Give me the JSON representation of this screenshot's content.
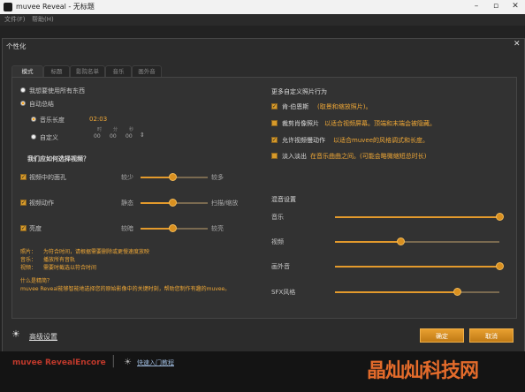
{
  "window": {
    "title": "muvee Reveal - 无标题"
  },
  "menu": [
    "文件(F)",
    "帮助(H)"
  ],
  "dialog": {
    "title": "个性化",
    "tabs": [
      "模式",
      "标题",
      "影院名单",
      "音乐",
      "画外音"
    ],
    "left": {
      "radio_manual": "我想要使用所有东西",
      "radio_auto": "自动总结",
      "sub_music_len": "音乐长度",
      "music_len_value": "02:03",
      "sub_custom": "自定义",
      "time_units": [
        "时",
        "分",
        "秒"
      ],
      "time_values": [
        "00",
        "00",
        "00"
      ],
      "how_heading": "我们应如何选择视频？",
      "sliders": [
        {
          "label": "视频中的面孔",
          "left": "较少",
          "right": "较多",
          "value": 0.48
        },
        {
          "label": "视频动作",
          "left": "静态",
          "right": "扫描/缩放",
          "value": 0.48
        },
        {
          "label": "亮度",
          "left": "较暗",
          "right": "较亮",
          "value": 0.48
        }
      ],
      "notes": [
        {
          "k": "照片：",
          "v": "为符合时间，请根据需要删除或更慢速度放映"
        },
        {
          "k": "音乐：",
          "v": "播放所有音轨"
        },
        {
          "k": "视频：",
          "v": "需要时截选以符合时间"
        }
      ],
      "what_title": "什么是精简？",
      "what_desc": "muvee Reveal能够智能地选择您的原始影像中的关键时刻，帮助您制作有趣的muvee。"
    },
    "right": {
      "more_heading": "更多自定义照片行为",
      "options": [
        {
          "checked": true,
          "label": "肯·伯恩斯",
          "desc": "(取景和缩放照片)。"
        },
        {
          "checked": false,
          "label": "裁剪肖像照片",
          "desc": "以适合视频屏幕。顶端和末端会被隐藏。"
        },
        {
          "checked": true,
          "label": "允许视频慢动作",
          "desc": "以适合muvee的风格调式和长度。"
        },
        {
          "checked": false,
          "label": "淡入淡出",
          "desc": "在音乐曲曲之间。(可能会略微缩短总时长)"
        }
      ],
      "mix_heading": "混音设置",
      "mix": [
        {
          "label": "音乐",
          "value": 1.0
        },
        {
          "label": "视频",
          "value": 0.4
        },
        {
          "label": "画外音",
          "value": 1.0
        },
        {
          "label": "SFX风格",
          "value": 0.74
        }
      ]
    },
    "advanced": "高级设置",
    "ok": "确定",
    "cancel": "取消"
  },
  "footer": {
    "brand": "muvee RevealEncore",
    "link": "快速入门教程"
  },
  "watermark": "晶灿灿科技网"
}
